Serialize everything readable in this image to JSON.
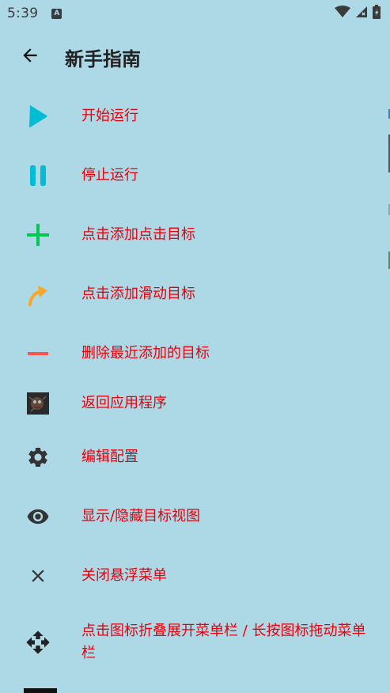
{
  "status_bar": {
    "time": "5:39",
    "notification_icon": "a-notification-icon",
    "wifi_icon": "wifi-icon",
    "signal_icon": "signal-icon",
    "battery_icon": "battery-icon"
  },
  "app_bar": {
    "title": "新手指南",
    "back_icon": "arrow-back-icon"
  },
  "guide": {
    "items": [
      {
        "label": "开始运行",
        "icon": "play-icon",
        "color": "#00bcd4"
      },
      {
        "label": "停止运行",
        "icon": "pause-icon",
        "color": "#00bcd4"
      },
      {
        "label": "点击添加点击目标",
        "icon": "plus-icon",
        "color": "#00c853"
      },
      {
        "label": "点击添加滑动目标",
        "icon": "swipe-arrow-icon",
        "color": "#f9a825"
      },
      {
        "label": "删除最近添加的目标",
        "icon": "minus-icon",
        "color": "#ff5252"
      },
      {
        "label": "返回应用程序",
        "icon": "app-thumbnail-icon",
        "color": "#2a2a2a"
      },
      {
        "label": "编辑配置",
        "icon": "gear-icon",
        "color": "#333333"
      },
      {
        "label": "显示/隐藏目标视图",
        "icon": "eye-icon",
        "color": "#333333"
      },
      {
        "label": "关闭悬浮菜单",
        "icon": "close-icon",
        "color": "#333333"
      },
      {
        "label": "点击图标折叠展开菜单栏 / 长按图标拖动菜单栏",
        "icon": "move-icon",
        "color": "#222222"
      }
    ]
  },
  "colors": {
    "background": "#add8e6",
    "label": "#e8000b",
    "title": "#222222"
  }
}
